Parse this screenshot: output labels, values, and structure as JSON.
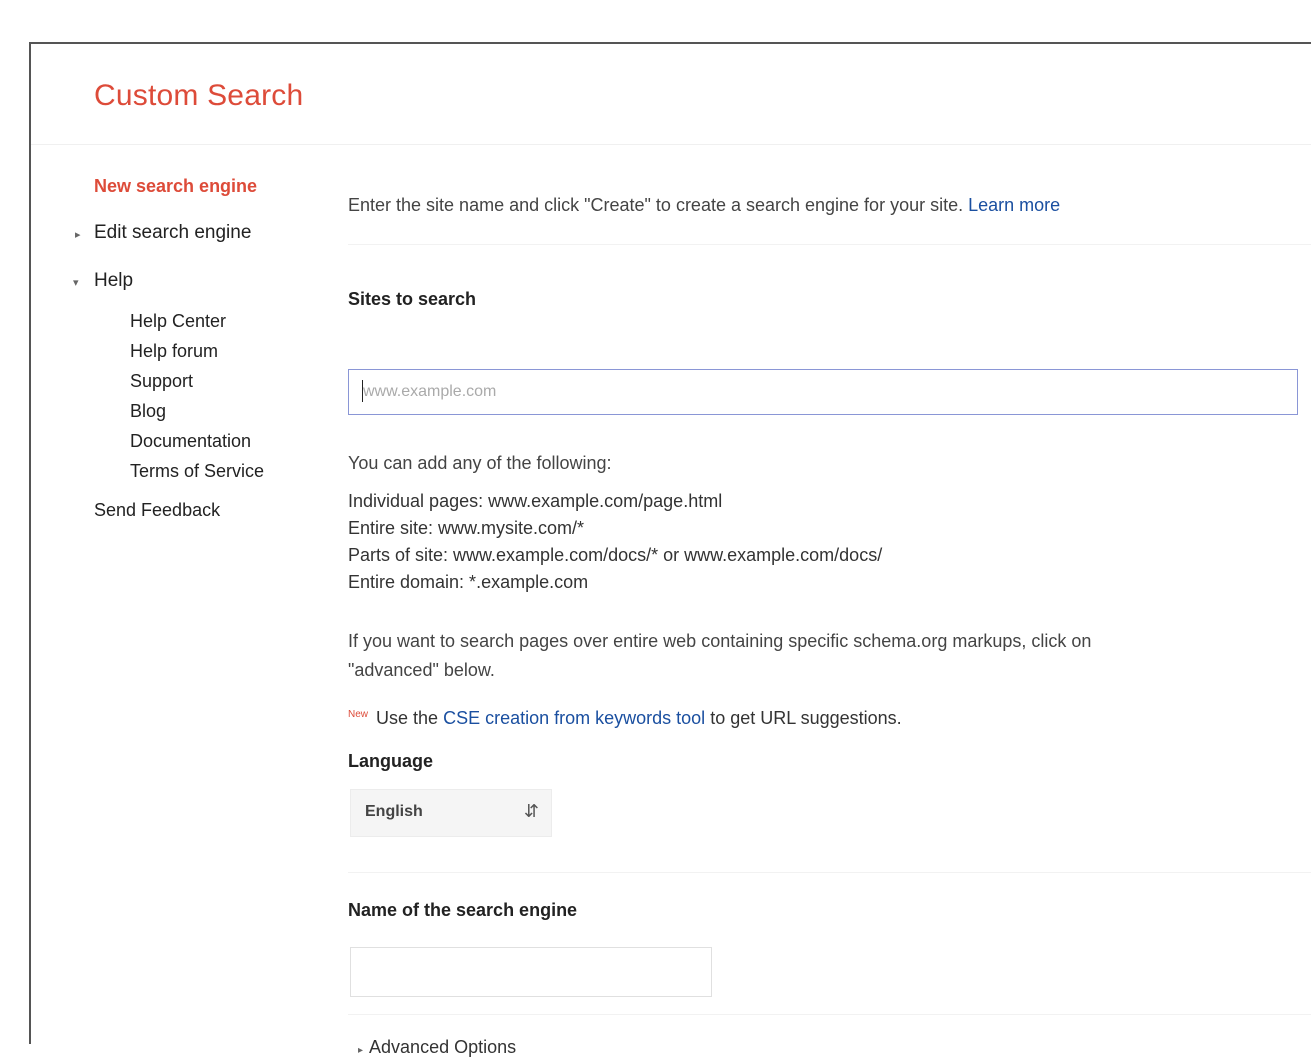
{
  "app": {
    "title": "Custom Search"
  },
  "sidebar": {
    "new_engine": "New search engine",
    "edit_engine": "Edit search engine",
    "help": "Help",
    "help_items": [
      "Help Center",
      "Help forum",
      "Support",
      "Blog",
      "Documentation",
      "Terms of Service"
    ],
    "send_feedback": "Send Feedback"
  },
  "main": {
    "intro_text": "Enter the site name and click \"Create\" to create a search engine for your site.",
    "learn_more": "Learn more",
    "sites_label": "Sites to search",
    "sites_placeholder": "www.example.com",
    "sites_value": "",
    "add_intro": "You can add any of the following:",
    "examples": [
      "Individual pages: www.example.com/page.html",
      "Entire site: www.mysite.com/*",
      "Parts of site: www.example.com/docs/* or www.example.com/docs/",
      "Entire domain: *.example.com"
    ],
    "schema_line1": "If you want to search pages over entire web containing specific schema.org markups, click on",
    "schema_line2": "\"advanced\" below.",
    "new_badge": "New",
    "keyword_prefix": "Use the",
    "keyword_link": "CSE creation from keywords tool",
    "keyword_suffix": "to get URL suggestions.",
    "language_label": "Language",
    "language_value": "English",
    "name_label": "Name of the search engine",
    "name_value": "",
    "advanced_options": "Advanced Options"
  },
  "colors": {
    "brand_red": "#dd4b39",
    "link_blue": "#1a4fa0",
    "input_focus_border": "#8a96d6"
  }
}
